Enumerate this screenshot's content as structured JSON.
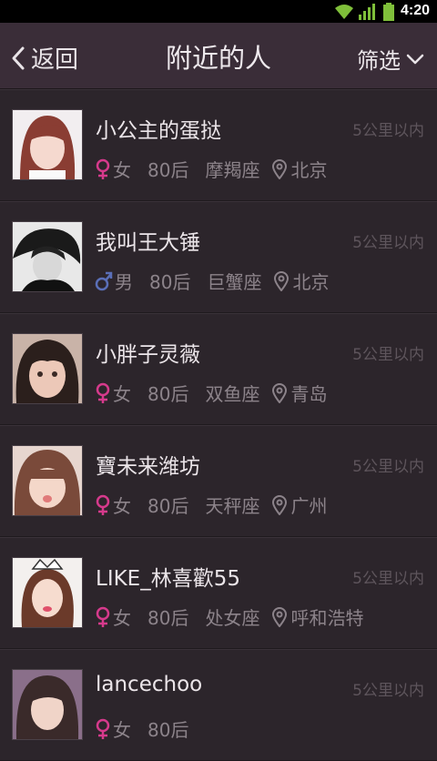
{
  "status_bar": {
    "time": "4:20"
  },
  "nav": {
    "back_label": "返回",
    "title": "附近的人",
    "filter_label": "筛选"
  },
  "colors": {
    "female": "#d63a8c",
    "male": "#5a6fb8",
    "navbar": "#3a2d38",
    "background": "#2a2329"
  },
  "people": [
    {
      "name": "小公主的蛋挞",
      "distance": "5公里以内",
      "gender": "女",
      "gender_icon": "female-icon",
      "age": "80后",
      "zodiac": "摩羯座",
      "location": "北京"
    },
    {
      "name": "我叫王大锤",
      "distance": "5公里以内",
      "gender": "男",
      "gender_icon": "male-icon",
      "age": "80后",
      "zodiac": "巨蟹座",
      "location": "北京"
    },
    {
      "name": "小胖子灵薇",
      "distance": "5公里以内",
      "gender": "女",
      "gender_icon": "female-icon",
      "age": "80后",
      "zodiac": "双鱼座",
      "location": "青岛"
    },
    {
      "name": "寶未来潍坊",
      "distance": "5公里以内",
      "gender": "女",
      "gender_icon": "female-icon",
      "age": "80后",
      "zodiac": "天秤座",
      "location": "广州"
    },
    {
      "name": "LIKE_林喜歡55",
      "distance": "5公里以内",
      "gender": "女",
      "gender_icon": "female-icon",
      "age": "80后",
      "zodiac": "处女座",
      "location": "呼和浩特"
    },
    {
      "name": "lancechoo",
      "distance": "5公里以内",
      "gender": "女",
      "gender_icon": "female-icon",
      "age": "80后",
      "zodiac": "",
      "location": ""
    }
  ]
}
